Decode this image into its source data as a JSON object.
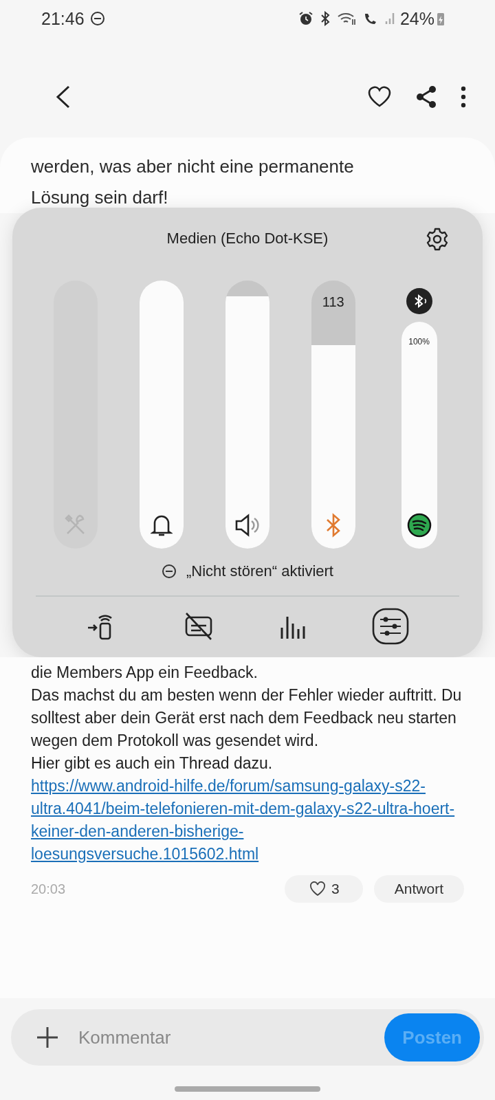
{
  "status_bar": {
    "time": "21:46",
    "battery": "24%"
  },
  "article": {
    "lines": [
      "werden, was aber nicht eine permanente",
      "Lösung sein darf!"
    ]
  },
  "volume_panel": {
    "title": "Medien (Echo Dot-KSE)",
    "sliders": [
      {
        "kind": "system",
        "disabled": true,
        "level": 0
      },
      {
        "kind": "ringtone",
        "disabled": false,
        "level": 1
      },
      {
        "kind": "media",
        "disabled": false,
        "level": 0.94
      },
      {
        "kind": "bluetooth",
        "disabled": false,
        "level": 0.76,
        "value": "113"
      },
      {
        "kind": "app",
        "disabled": false,
        "level": 1,
        "value": "100%"
      }
    ],
    "dnd_notice": "„Nicht stören“ aktiviert"
  },
  "post": {
    "paragraphs": [
      "die Members App ein Feedback.",
      "Das machst du am besten wenn der Fehler wieder auftritt. Du solltest aber dein Gerät erst nach dem Feedback neu starten wegen dem Protokoll was gesendet wird.",
      "Hier gibt es auch ein Thread dazu."
    ],
    "link": "https://www.android-hilfe.de/forum/samsung-galaxy-s22-ultra.4041/beim-telefonieren-mit-dem-galaxy-s22-ultra-hoert-keiner-den-anderen-bisherige-loesungsversuche.1015602.html",
    "time": "20:03",
    "likes": "3",
    "reply_button": "Antwort"
  },
  "comment_bar": {
    "placeholder": "Kommentar",
    "post_button": "Posten"
  }
}
